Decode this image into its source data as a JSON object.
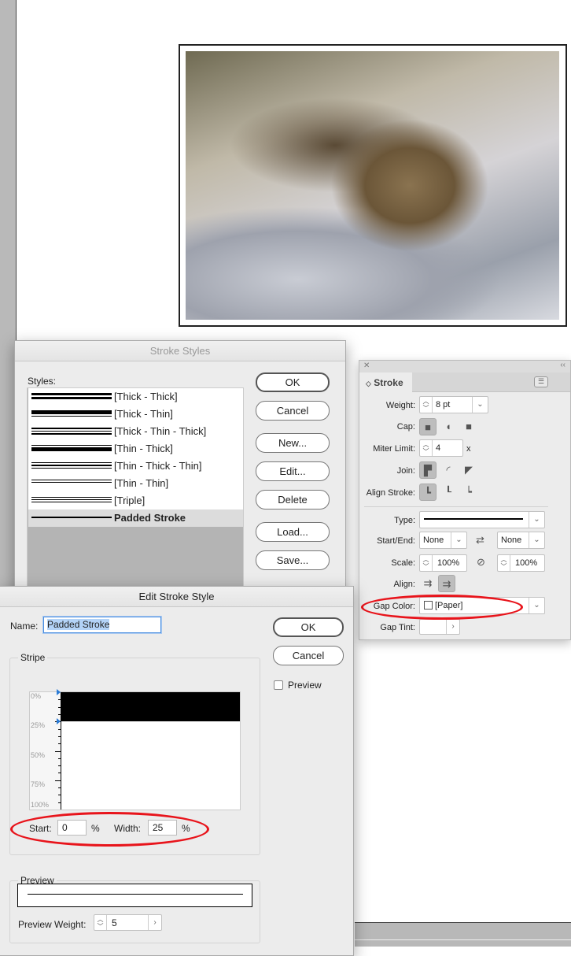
{
  "stroke_styles_dialog": {
    "title": "Stroke Styles",
    "styles_label": "Styles:",
    "styles": [
      {
        "label": "[Thick - Thick]",
        "pattern": [
          3,
          3
        ]
      },
      {
        "label": "[Thick - Thin]",
        "pattern": [
          5,
          1
        ]
      },
      {
        "label": "[Thick - Thin - Thick]",
        "pattern": [
          2,
          1,
          2
        ]
      },
      {
        "label": "[Thin - Thick]",
        "pattern": [
          1,
          5
        ]
      },
      {
        "label": "[Thin - Thick - Thin]",
        "pattern": [
          1,
          2,
          1
        ]
      },
      {
        "label": "[Thin - Thin]",
        "pattern": [
          1,
          1
        ]
      },
      {
        "label": "[Triple]",
        "pattern": [
          1,
          1,
          1
        ]
      },
      {
        "label": "Padded Stroke",
        "pattern": [
          2
        ],
        "selected": true
      }
    ],
    "buttons": {
      "ok": "OK",
      "cancel": "Cancel",
      "new": "New...",
      "edit": "Edit...",
      "delete": "Delete",
      "load": "Load...",
      "save": "Save..."
    }
  },
  "edit_dialog": {
    "title": "Edit Stroke Style",
    "name_label": "Name:",
    "name_value": "Padded Stroke",
    "ok": "OK",
    "cancel": "Cancel",
    "preview_checkbox": "Preview",
    "stripe_label": "Stripe",
    "ruler": [
      "0%",
      "25%",
      "50%",
      "75%",
      "100%"
    ],
    "stripe_start_pct": 0,
    "stripe_width_pct": 25,
    "start_label": "Start:",
    "start_value": "0",
    "start_unit": "%",
    "width_label": "Width:",
    "width_value": "25",
    "width_unit": "%",
    "preview_label": "Preview",
    "preview_weight_label": "Preview Weight:",
    "preview_weight_value": "5"
  },
  "stroke_panel": {
    "tab": "Stroke",
    "weight_label": "Weight:",
    "weight_value": "8 pt",
    "cap_label": "Cap:",
    "miter_label": "Miter Limit:",
    "miter_value": "4",
    "miter_unit": "x",
    "join_label": "Join:",
    "align_stroke_label": "Align Stroke:",
    "type_label": "Type:",
    "startend_label": "Start/End:",
    "start_value": "None",
    "end_value": "None",
    "scale_label": "Scale:",
    "scale_start": "100%",
    "scale_end": "100%",
    "align_label": "Align:",
    "gap_color_label": "Gap Color:",
    "gap_color_value": "[Paper]",
    "gap_tint_label": "Gap Tint:",
    "gap_tint_value": ""
  },
  "colors": {
    "highlight": "#e8141b",
    "accent": "#2a7bd6"
  }
}
